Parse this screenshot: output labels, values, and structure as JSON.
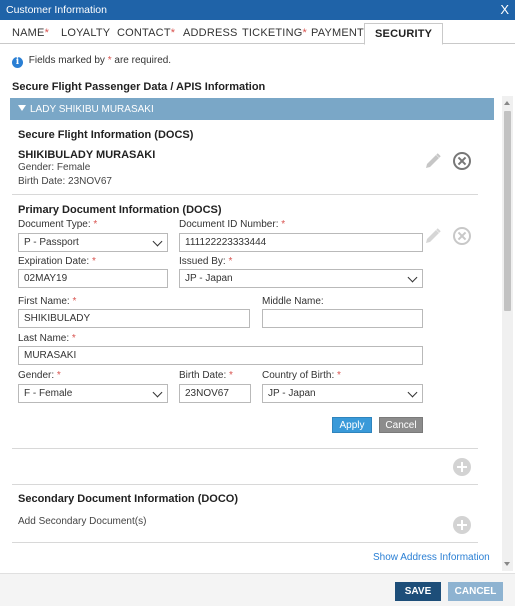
{
  "window": {
    "title": "Customer Information",
    "close_glyph": "X"
  },
  "tabs": [
    {
      "label": "NAME",
      "required": "*"
    },
    {
      "label": "LOYALTY",
      "required": ""
    },
    {
      "label": "CONTACT",
      "required": "*"
    },
    {
      "label": "ADDRESS",
      "required": ""
    },
    {
      "label": "TICKETING",
      "required": "*"
    },
    {
      "label": "PAYMENT",
      "required": ""
    },
    {
      "label": "SECURITY",
      "required": ""
    }
  ],
  "info": {
    "icon": "info-icon",
    "prefix": "Fields marked by",
    "star": "*",
    "suffix": "are required."
  },
  "section_title": "Secure Flight Passenger Data / APIS Information",
  "passenger": {
    "header": "LADY SHIKIBU MURASAKI"
  },
  "docs_summary": {
    "title": "Secure Flight Information (DOCS)",
    "name": "SHIKIBULADY MURASAKI",
    "gender": "Gender: Female",
    "birth": "Birth Date: 23NOV67"
  },
  "primary_doc": {
    "title": "Primary Document Information (DOCS)",
    "doc_type": {
      "label": "Document Type:",
      "value": "P - Passport"
    },
    "doc_id": {
      "label": "Document ID Number:",
      "value": "111122223333444"
    },
    "expiration": {
      "label": "Expiration Date:",
      "value": "02MAY19"
    },
    "issued_by": {
      "label": "Issued By:",
      "value": "JP - Japan"
    },
    "first_name": {
      "label": "First Name:",
      "value": "SHIKIBULADY"
    },
    "middle_name": {
      "label": "Middle Name:",
      "value": ""
    },
    "last_name": {
      "label": "Last Name:",
      "value": "MURASAKI"
    },
    "gender": {
      "label": "Gender:",
      "value": "F - Female"
    },
    "birth_date": {
      "label": "Birth Date:",
      "value": "23NOV67"
    },
    "country_of_birth": {
      "label": "Country of Birth:",
      "value": "JP - Japan"
    },
    "required_mark": "*",
    "apply_label": "Apply",
    "cancel_label": "Cancel"
  },
  "secondary_doc": {
    "title": "Secondary Document Information (DOCO)",
    "add_label": "Add Secondary Document(s)"
  },
  "show_address_link": "Show Address Information",
  "footer": {
    "save_label": "SAVE",
    "cancel_label": "CANCEL"
  },
  "colors": {
    "titlebar": "#1f63a8",
    "accent": "#2a7fd4",
    "required": "#d9534f",
    "pax_header": "#7aa7c7",
    "save": "#1d4e79",
    "cancel": "#8eb3d1"
  }
}
